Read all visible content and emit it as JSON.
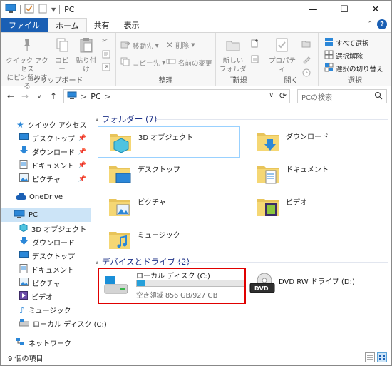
{
  "title": "PC",
  "window_controls": {
    "minimize": "—",
    "maximize": "☐",
    "close": "✕"
  },
  "tabs": [
    {
      "label": "ファイル"
    },
    {
      "label": "ホーム"
    },
    {
      "label": "共有"
    },
    {
      "label": "表示"
    }
  ],
  "ribbon": {
    "clipboard": {
      "group_label": "クリップボード",
      "pin_label": "クイック アクセス\nにピン留めする",
      "copy_label": "コピー",
      "paste_label": "貼り付け"
    },
    "organize": {
      "group_label": "整理",
      "move_to": "移動先",
      "copy_to": "コピー先",
      "delete": "削除",
      "rename": "名前の変更"
    },
    "new": {
      "group_label": "新規",
      "new_folder": "新しい\nフォルダー"
    },
    "open": {
      "group_label": "開く",
      "properties": "プロパティ"
    },
    "select": {
      "group_label": "選択",
      "select_all": "すべて選択",
      "select_none": "選択解除",
      "invert": "選択の切り替え"
    }
  },
  "address": {
    "path": "PC",
    "separator": ">",
    "search_placeholder": "PCの検索"
  },
  "sidebar": {
    "items": [
      {
        "label": "クイック アクセス",
        "icon": "star-icon"
      },
      {
        "label": "デスクトップ",
        "icon": "desktop-icon",
        "pinned": true
      },
      {
        "label": "ダウンロード",
        "icon": "download-icon",
        "pinned": true
      },
      {
        "label": "ドキュメント",
        "icon": "document-icon",
        "pinned": true
      },
      {
        "label": "ピクチャ",
        "icon": "picture-icon",
        "pinned": true
      },
      {
        "label": "OneDrive",
        "icon": "cloud-icon"
      },
      {
        "label": "PC",
        "icon": "pc-icon",
        "selected": true
      },
      {
        "label": "3D オブジェクト",
        "icon": "cube-icon"
      },
      {
        "label": "ダウンロード",
        "icon": "download-icon"
      },
      {
        "label": "デスクトップ",
        "icon": "desktop-icon"
      },
      {
        "label": "ドキュメント",
        "icon": "document-icon"
      },
      {
        "label": "ピクチャ",
        "icon": "picture-icon"
      },
      {
        "label": "ビデオ",
        "icon": "video-icon"
      },
      {
        "label": "ミュージック",
        "icon": "music-icon"
      },
      {
        "label": "ローカル ディスク (C:)",
        "icon": "drive-icon"
      },
      {
        "label": "ネットワーク",
        "icon": "network-icon"
      }
    ]
  },
  "content": {
    "folders_header": "フォルダー (7)",
    "folders": [
      {
        "label": "3D オブジェクト",
        "icon": "cube-folder-icon"
      },
      {
        "label": "ダウンロード",
        "icon": "download-folder-icon"
      },
      {
        "label": "デスクトップ",
        "icon": "desktop-folder-icon"
      },
      {
        "label": "ドキュメント",
        "icon": "document-folder-icon"
      },
      {
        "label": "ピクチャ",
        "icon": "picture-folder-icon"
      },
      {
        "label": "ビデオ",
        "icon": "video-folder-icon"
      },
      {
        "label": "ミュージック",
        "icon": "music-folder-icon"
      }
    ],
    "devices_header": "デバイスとドライブ (2)",
    "drives": [
      {
        "label": "ローカル ディスク (C:)",
        "free_text": "空き領域 856 GB/927 GB",
        "used_fraction": 0.077
      },
      {
        "label": "DVD RW ドライブ (D:)",
        "badge": "DVD"
      }
    ]
  },
  "status": {
    "count": "9 個の項目"
  },
  "colors": {
    "file_tab": "#1a5fb4",
    "selection": "#cce4f7",
    "section_header": "#1e3287",
    "highlight_box": "#e00000",
    "drive_bar": "#26a0da"
  }
}
